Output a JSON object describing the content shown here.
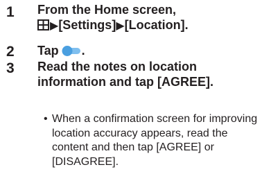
{
  "steps": [
    {
      "number": "1",
      "line1": "From the Home screen,",
      "line2_parts": {
        "arrow1": "▶",
        "settings": "[Settings]",
        "arrow2": "▶",
        "location": "[Location]."
      },
      "icon": "apps-grid-icon"
    },
    {
      "number": "2",
      "text": "Tap",
      "end": ".",
      "icon": "toggle-switch-icon",
      "toggle_color": "#5aa9e6"
    },
    {
      "number": "3",
      "line1": "Read the notes on location",
      "line2": "information and tap [AGREE]."
    }
  ],
  "note": {
    "bullet": "•",
    "text": "When a confirmation screen for improving location accuracy appears, read the content and then tap [AGREE] or [DISAGREE]."
  }
}
